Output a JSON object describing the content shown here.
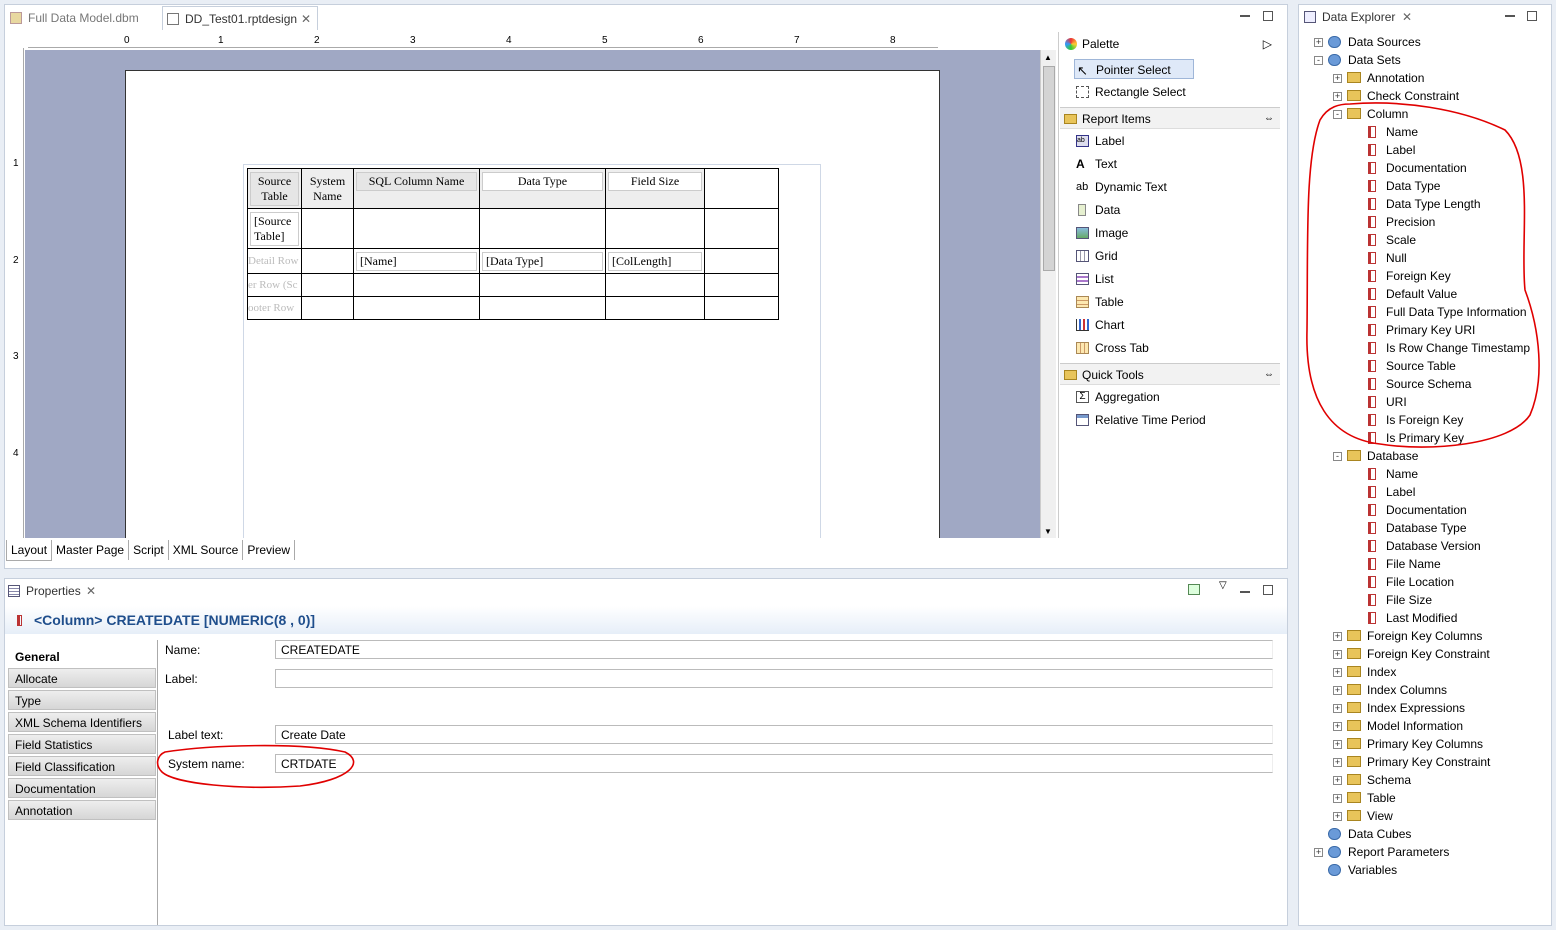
{
  "editor": {
    "tabs": [
      {
        "label": "Full Data Model.dbm"
      },
      {
        "label": "DD_Test01.rptdesign"
      }
    ],
    "ruler_h": [
      "0",
      "1",
      "2",
      "3",
      "4",
      "5",
      "6",
      "7",
      "8"
    ],
    "ruler_v": [
      "1",
      "2",
      "3",
      "4"
    ],
    "table": {
      "headers": [
        "Source\nTable",
        "System\nName",
        "SQL Column Name",
        "Data Type",
        "Field Size",
        ""
      ],
      "group_row": [
        "[Source\nTable]",
        "",
        "",
        "",
        "",
        ""
      ],
      "detail_row_label": "Detail Row",
      "detail_row": [
        "[Name]",
        "[Data Type]",
        "[ColLength]"
      ],
      "footer1_label": "er Row (Sc",
      "footer2_label": "ooter Row"
    },
    "bottom_tabs": [
      "Layout",
      "Master Page",
      "Script",
      "XML Source",
      "Preview"
    ]
  },
  "palette": {
    "title": "Palette",
    "tools": [
      {
        "label": "Pointer Select",
        "icon": "pointer-icon"
      },
      {
        "label": "Rectangle Select",
        "icon": "rectangle-select-icon"
      }
    ],
    "report_items_title": "Report Items",
    "report_items": [
      {
        "label": "Label",
        "icon": "label-icon"
      },
      {
        "label": "Text",
        "icon": "text-icon"
      },
      {
        "label": "Dynamic Text",
        "icon": "dynamic-text-icon"
      },
      {
        "label": "Data",
        "icon": "data-icon"
      },
      {
        "label": "Image",
        "icon": "image-icon"
      },
      {
        "label": "Grid",
        "icon": "grid-icon"
      },
      {
        "label": "List",
        "icon": "list-icon"
      },
      {
        "label": "Table",
        "icon": "table-icon"
      },
      {
        "label": "Chart",
        "icon": "chart-icon"
      },
      {
        "label": "Cross Tab",
        "icon": "cross-tab-icon"
      }
    ],
    "quick_tools_title": "Quick Tools",
    "quick_tools": [
      {
        "label": "Aggregation",
        "icon": "sigma-icon"
      },
      {
        "label": "Relative Time Period",
        "icon": "calendar-icon"
      }
    ]
  },
  "properties": {
    "tab_label": "Properties",
    "title": "<Column> CREATEDATE [NUMERIC(8 , 0)]",
    "categories": [
      "General",
      "Allocate",
      "Type",
      "XML Schema Identifiers",
      "Field Statistics",
      "Field Classification",
      "Documentation",
      "Annotation"
    ],
    "fields": {
      "name_label": "Name:",
      "name_value": "CREATEDATE",
      "label_label": "Label:",
      "label_value": "",
      "label_text_label": "Label text:",
      "label_text_value": "Create Date",
      "system_name_label": "System name:",
      "system_name_value": "CRTDATE"
    }
  },
  "explorer": {
    "tab_label": "Data Explorer",
    "nodes": [
      {
        "label": "Data Sources",
        "level": 0,
        "exp": "+",
        "type": "ds"
      },
      {
        "label": "Data Sets",
        "level": 0,
        "exp": "-",
        "type": "ds"
      },
      {
        "label": "Annotation",
        "level": 1,
        "exp": "+",
        "type": "fold"
      },
      {
        "label": "Check Constraint",
        "level": 1,
        "exp": "+",
        "type": "fold"
      },
      {
        "label": "Column",
        "level": 1,
        "exp": "-",
        "type": "fold"
      },
      {
        "label": "Name",
        "level": 2,
        "type": "col"
      },
      {
        "label": "Label",
        "level": 2,
        "type": "col"
      },
      {
        "label": "Documentation",
        "level": 2,
        "type": "col"
      },
      {
        "label": "Data Type",
        "level": 2,
        "type": "col"
      },
      {
        "label": "Data Type Length",
        "level": 2,
        "type": "col"
      },
      {
        "label": "Precision",
        "level": 2,
        "type": "col"
      },
      {
        "label": "Scale",
        "level": 2,
        "type": "col"
      },
      {
        "label": "Null",
        "level": 2,
        "type": "col"
      },
      {
        "label": "Foreign Key",
        "level": 2,
        "type": "col"
      },
      {
        "label": "Default Value",
        "level": 2,
        "type": "col"
      },
      {
        "label": "Full Data Type Information",
        "level": 2,
        "type": "col"
      },
      {
        "label": "Primary Key URI",
        "level": 2,
        "type": "col"
      },
      {
        "label": "Is Row Change Timestamp",
        "level": 2,
        "type": "col"
      },
      {
        "label": "Source Table",
        "level": 2,
        "type": "col"
      },
      {
        "label": "Source Schema",
        "level": 2,
        "type": "col"
      },
      {
        "label": "URI",
        "level": 2,
        "type": "col"
      },
      {
        "label": "Is Foreign Key",
        "level": 2,
        "type": "col"
      },
      {
        "label": "Is Primary Key",
        "level": 2,
        "type": "col"
      },
      {
        "label": "Database",
        "level": 1,
        "exp": "-",
        "type": "fold"
      },
      {
        "label": "Name",
        "level": 2,
        "type": "col"
      },
      {
        "label": "Label",
        "level": 2,
        "type": "col"
      },
      {
        "label": "Documentation",
        "level": 2,
        "type": "col"
      },
      {
        "label": "Database Type",
        "level": 2,
        "type": "col"
      },
      {
        "label": "Database Version",
        "level": 2,
        "type": "col"
      },
      {
        "label": "File Name",
        "level": 2,
        "type": "col"
      },
      {
        "label": "File Location",
        "level": 2,
        "type": "col"
      },
      {
        "label": "File Size",
        "level": 2,
        "type": "col"
      },
      {
        "label": "Last Modified",
        "level": 2,
        "type": "col"
      },
      {
        "label": "Foreign Key Columns",
        "level": 1,
        "exp": "+",
        "type": "fold"
      },
      {
        "label": "Foreign Key Constraint",
        "level": 1,
        "exp": "+",
        "type": "fold"
      },
      {
        "label": "Index",
        "level": 1,
        "exp": "+",
        "type": "fold"
      },
      {
        "label": "Index Columns",
        "level": 1,
        "exp": "+",
        "type": "fold"
      },
      {
        "label": "Index Expressions",
        "level": 1,
        "exp": "+",
        "type": "fold"
      },
      {
        "label": "Model Information",
        "level": 1,
        "exp": "+",
        "type": "fold"
      },
      {
        "label": "Primary Key Columns",
        "level": 1,
        "exp": "+",
        "type": "fold"
      },
      {
        "label": "Primary Key Constraint",
        "level": 1,
        "exp": "+",
        "type": "fold"
      },
      {
        "label": "Schema",
        "level": 1,
        "exp": "+",
        "type": "fold"
      },
      {
        "label": "Table",
        "level": 1,
        "exp": "+",
        "type": "fold"
      },
      {
        "label": "View",
        "level": 1,
        "exp": "+",
        "type": "fold"
      },
      {
        "label": "Data Cubes",
        "level": 0,
        "type": "ds"
      },
      {
        "label": "Report Parameters",
        "level": 0,
        "exp": "+",
        "type": "ds"
      },
      {
        "label": "Variables",
        "level": 0,
        "type": "ds"
      }
    ]
  }
}
